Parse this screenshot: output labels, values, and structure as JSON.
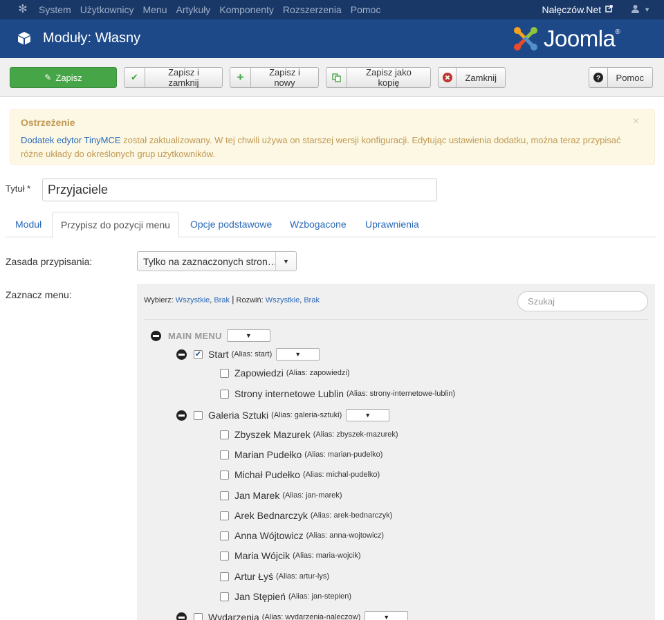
{
  "navbar": {
    "items": [
      "System",
      "Użytkownicy",
      "Menu",
      "Artykuły",
      "Komponenty",
      "Rozszerzenia",
      "Pomoc"
    ],
    "site_name": "Nałęczów.Net",
    "icons": {
      "joomla": "joomla-icon",
      "external": "external-link-icon",
      "user": "user-icon",
      "caret": "caret-down-icon"
    }
  },
  "header": {
    "title": "Moduły: Własny",
    "brand": "Joomla!"
  },
  "toolbar": {
    "save": "Zapisz",
    "save_close": "Zapisz i zamknij",
    "save_new": "Zapisz i nowy",
    "save_copy": "Zapisz jako kopię",
    "close": "Zamknij",
    "help": "Pomoc"
  },
  "alert": {
    "title": "Ostrzeżenie",
    "link": "Dodatek edytor TinyMCE",
    "text": " został zaktualizowany. W tej chwili używa on starszej wersji konfiguracji. Edytując ustawienia dodatku, można teraz przypisać różne układy do określonych grup użytkowników.",
    "close": "×"
  },
  "form": {
    "title_label": "Tytuł *",
    "title_value": "Przyjaciele"
  },
  "tabs": [
    "Moduł",
    "Przypisz do pozycji menu",
    "Opcje podstawowe",
    "Wzbogacone",
    "Uprawnienia"
  ],
  "assignment": {
    "label": "Zasada przypisania:",
    "value": "Tylko na zaznaczonych stron…"
  },
  "menu_select": {
    "label": "Zaznacz menu:",
    "select_label": "Wybierz:",
    "expand_label": "Rozwiń:",
    "all": "Wszystkie",
    "none": "Brak",
    "search_placeholder": "Szukaj"
  },
  "tree": {
    "menu_name": "MAIN MENU",
    "items": [
      {
        "name": "Start",
        "alias": "(Alias: start)",
        "checked": true,
        "level": 1,
        "expandable": true
      },
      {
        "name": "Zapowiedzi",
        "alias": "(Alias: zapowiedzi)",
        "checked": false,
        "level": 2
      },
      {
        "name": "Strony internetowe Lublin",
        "alias": "(Alias: strony-internetowe-lublin)",
        "checked": false,
        "level": 2
      },
      {
        "name": "Galeria Sztuki",
        "alias": "(Alias: galeria-sztuki)",
        "checked": false,
        "level": 1,
        "expandable": true
      },
      {
        "name": "Zbyszek Mazurek",
        "alias": "(Alias: zbyszek-mazurek)",
        "checked": false,
        "level": 2
      },
      {
        "name": "Marian Pudełko",
        "alias": "(Alias: marian-pudelko)",
        "checked": false,
        "level": 2
      },
      {
        "name": "Michał Pudełko",
        "alias": "(Alias: michal-pudelko)",
        "checked": false,
        "level": 2
      },
      {
        "name": "Jan Marek",
        "alias": "(Alias: jan-marek)",
        "checked": false,
        "level": 2
      },
      {
        "name": "Arek Bednarczyk",
        "alias": "(Alias: arek-bednarczyk)",
        "checked": false,
        "level": 2
      },
      {
        "name": "Anna Wójtowicz",
        "alias": "(Alias: anna-wojtowicz)",
        "checked": false,
        "level": 2
      },
      {
        "name": "Maria Wójcik",
        "alias": "(Alias: maria-wojcik)",
        "checked": false,
        "level": 2
      },
      {
        "name": "Artur Łyś",
        "alias": "(Alias: artur-lys)",
        "checked": false,
        "level": 2
      },
      {
        "name": "Jan Stępień",
        "alias": "(Alias: jan-stepien)",
        "checked": false,
        "level": 2
      },
      {
        "name": "Wydarzenia",
        "alias": "(Alias: wydarzenia-naleczow)",
        "checked": false,
        "level": 1,
        "expandable": true
      }
    ]
  },
  "colors": {
    "navbar": "#1a3867",
    "header": "#1d4989",
    "save_green": "#46a546",
    "link": "#2a69b8",
    "alert_bg": "#fcf8e3",
    "alert_text": "#c09853"
  }
}
